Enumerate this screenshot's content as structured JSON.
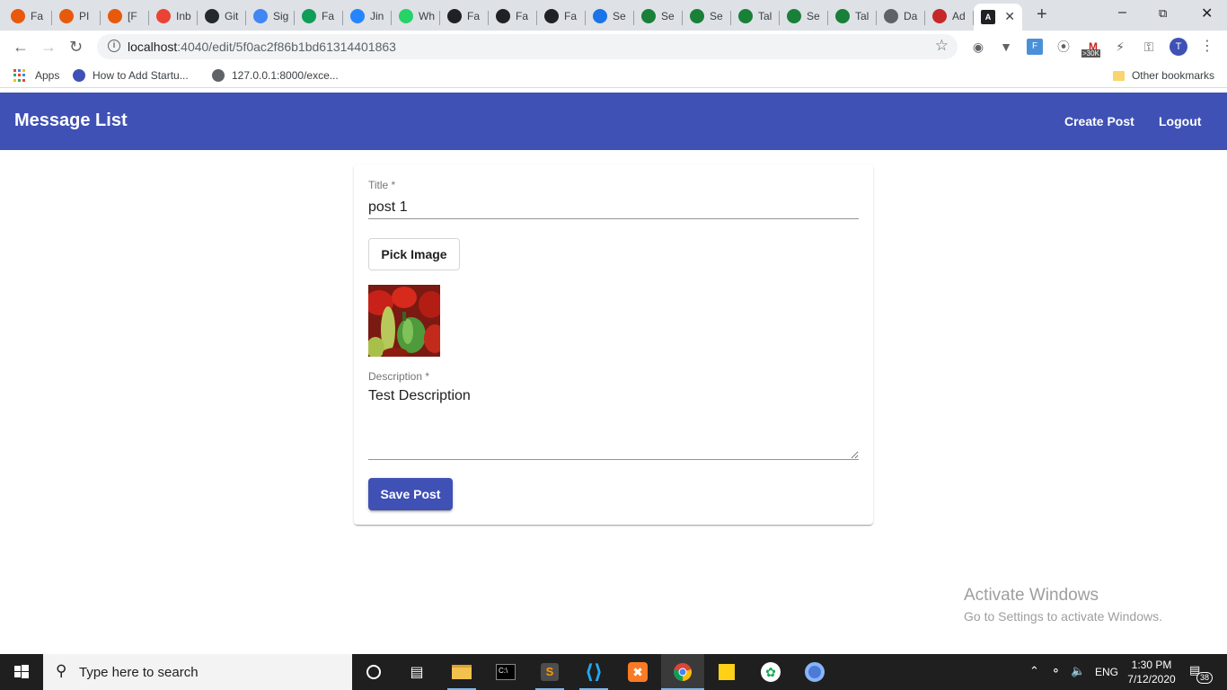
{
  "browser": {
    "tabs": [
      {
        "label": "Fa",
        "color": "#e8590c",
        "icon": "cloud-icon"
      },
      {
        "label": "PI",
        "color": "#e8590c",
        "icon": "cloud-icon"
      },
      {
        "label": "[F",
        "color": "#e8590c",
        "icon": "cloud-icon"
      },
      {
        "label": "Inb",
        "color": "#ea4335",
        "icon": "gmail-icon"
      },
      {
        "label": "Git",
        "color": "#24292e",
        "icon": "github-icon"
      },
      {
        "label": "Sig",
        "color": "#4285f4",
        "icon": "google-icon"
      },
      {
        "label": "Fa",
        "color": "#0f9d58",
        "icon": "sheets-icon"
      },
      {
        "label": "Jin",
        "color": "#2684ff",
        "icon": "jira-icon"
      },
      {
        "label": "Wh",
        "color": "#25d366",
        "icon": "whatsapp-icon"
      },
      {
        "label": "Fa",
        "color": "#202124",
        "icon": "circle-icon"
      },
      {
        "label": "Fa",
        "color": "#202124",
        "icon": "circle-icon"
      },
      {
        "label": "Fa",
        "color": "#202124",
        "icon": "circle-icon"
      },
      {
        "label": "Se",
        "color": "#1a73e8",
        "icon": "gear-icon"
      },
      {
        "label": "Se",
        "color": "#188038",
        "icon": "key-icon"
      },
      {
        "label": "Se",
        "color": "#188038",
        "icon": "key-icon"
      },
      {
        "label": "Tal",
        "color": "#188038",
        "icon": "key-icon"
      },
      {
        "label": "Se",
        "color": "#188038",
        "icon": "key-icon"
      },
      {
        "label": "Tal",
        "color": "#188038",
        "icon": "key-icon"
      },
      {
        "label": "Da",
        "color": "#5f6368",
        "icon": "globe-icon"
      },
      {
        "label": "Ad",
        "color": "#c62828",
        "icon": "mask-icon"
      },
      {
        "label": "",
        "color": "#202124",
        "icon": "angular-icon",
        "active": true
      }
    ],
    "url_host": "localhost",
    "url_path": ":4040/edit/5f0ac2f86b1bd61314401863",
    "ext_badge": ">30K",
    "profile_initial": "T",
    "bookmarks": {
      "apps_label": "Apps",
      "items": [
        "How to Add Startu...",
        "127.0.0.1:8000/exce..."
      ],
      "other_label": "Other bookmarks"
    }
  },
  "app": {
    "title": "Message List",
    "nav": {
      "create": "Create Post",
      "logout": "Logout"
    },
    "form": {
      "title_label": "Title *",
      "title_value": "post 1",
      "pick_image_label": "Pick Image",
      "description_label": "Description *",
      "description_value": "Test Description",
      "save_label": "Save Post"
    },
    "accent": "#3f51b5"
  },
  "watermark": {
    "line1": "Activate Windows",
    "line2": "Go to Settings to activate Windows."
  },
  "taskbar": {
    "search_placeholder": "Type here to search",
    "lang": "ENG",
    "time": "1:30 PM",
    "date": "7/12/2020",
    "notif_count": "38"
  }
}
